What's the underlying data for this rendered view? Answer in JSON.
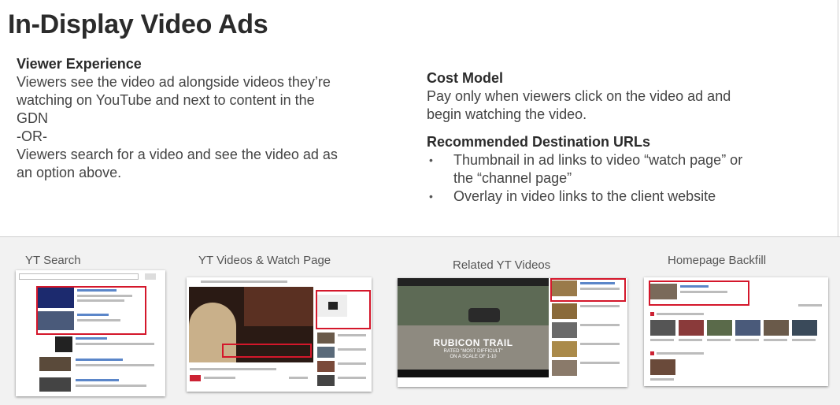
{
  "slide": {
    "title": "In-Display Video Ads",
    "viewer_experience": {
      "heading": "Viewer Experience",
      "lines": [
        "Viewers see the video ad alongside videos they’re",
        "watching on YouTube and next to content in the",
        "GDN",
        "-OR-",
        "Viewers search for a video and see the video ad as",
        "an option above."
      ]
    },
    "cost_model": {
      "heading": "Cost Model",
      "lines": [
        "Pay only when viewers click on the video ad and",
        "begin watching the video."
      ]
    },
    "destination_urls": {
      "heading": "Recommended Destination URLs",
      "bullets": [
        {
          "line1": "Thumbnail in ad links to video “watch page” or",
          "line2": "the “channel page”"
        },
        {
          "line1": "Overlay in video links to the client website",
          "line2": ""
        }
      ],
      "bullet_char": "•"
    },
    "thumbnails": [
      {
        "label": "YT Search"
      },
      {
        "label": "YT Videos & Watch Page"
      },
      {
        "label": "Related YT Videos",
        "overlay_title": "RUBICON TRAIL",
        "overlay_sub1": "RATED \"MOST DIFFICULT\"",
        "overlay_sub2": "ON A SCALE OF 1-10"
      },
      {
        "label": "Homepage Backfill"
      }
    ],
    "colors": {
      "highlight": "#d4172b",
      "band": "#f2f2f2",
      "title": "#2b2b2b"
    }
  }
}
